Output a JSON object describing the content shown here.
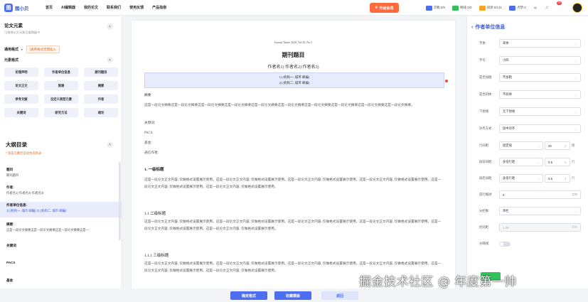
{
  "app": {
    "logo_char": "图",
    "logo_text": "图小贝"
  },
  "nav": [
    "首页",
    "AI编辑器",
    "我的论文",
    "联系我们",
    "使用反馈",
    "产品指南"
  ],
  "topbar": {
    "member_label": "升级会员",
    "quotas": [
      {
        "label": "次稿:0/5",
        "color": "#4e6ef2"
      },
      {
        "label": "畅排:0/0",
        "color": "#2fc25b"
      },
      {
        "label": "润译:0/131",
        "color": "#f5a623"
      },
      {
        "label": "点赞:0",
        "color": "#4e6ef2"
      }
    ],
    "notification_count": "99"
  },
  "left": {
    "section_title": "论文元素",
    "section_sub": "可拖拽论文元素至编辑器中",
    "format_label": "通用格式",
    "format_option": "(通用格式无需插入",
    "elements_label": "元素格式",
    "elements": [
      "论理声明",
      "作者单位信息",
      "期刊题目",
      "论文正文",
      "致谢",
      "摘要",
      "参考文献",
      "自定义类型元素",
      "作者",
      "关键词",
      "研究方法",
      "绪论"
    ],
    "outline_title": "大纲目录",
    "outline_tip": "* 双击元素后自动生成目录",
    "outline": [
      {
        "title": "题目",
        "value": "期刊题目"
      },
      {
        "title": "作者:",
        "value": "作者名1) 作者名2) 作者名3)"
      },
      {
        "title": "作者单位信息:",
        "value": "1) (机构一, 城市 邮编) 2) (机构二, 城市 邮编)"
      },
      {
        "title": "摘要:",
        "value": "这是一段论文摘要这是一段论文摘要这是一段论文摘要这是一"
      },
      {
        "title": "关键词",
        "value": ""
      },
      {
        "title": "PACS",
        "value": ""
      },
      {
        "title": "基金",
        "value": ""
      }
    ]
  },
  "doc": {
    "journal_info": "Journal Name 2020, Vol.45, No.5",
    "title": "期刊题目",
    "authors": "作者名1)  作者名2)  作者名3)",
    "affiliations": [
      "1) (机构一, 城市 邮编)",
      "2) (机构二, 城市 邮编)"
    ],
    "abstract_label": "摘要",
    "abstract_text": "这是一段论文摘要这是一段论文摘要这是一段论文摘要这是一段论文摘要这是一段论文摘要这是一段论文摘要这是一段论文摘要这是一段论文摘要这是一段论文摘要这是一段论文摘要。",
    "keywords_label": "关键词:",
    "pacs_label": "PACS:",
    "fund_label": "基金:",
    "correspond_label": "通信作者:",
    "h1": "1.   一级标题",
    "para": "这是一段论文正文内容, 仅做格式设置展示使用。这是一段论文正文内容, 仅做格式设置展示使用。这是一段论文正文内容, 仅做格式设置展示使用。这是一段论文正文内容, 仅做格式设置展示使用。这是一段论文正文内容, 仅做格式设置展示使用。这是一段论文正文内容, 仅做格式设置展示使用。",
    "h2": "1.1    二级标题",
    "h3": "1.1.1    三级标题"
  },
  "right": {
    "title": "作者单位信息",
    "rows": [
      {
        "label": "字体:",
        "value": "宋体"
      },
      {
        "label": "字号:",
        "value": "小四"
      },
      {
        "label": "是否加粗:",
        "value": "不加粗"
      },
      {
        "label": "是否斜体:",
        "value": "不斜体"
      },
      {
        "label": "下划线:",
        "value": "无下划线"
      },
      {
        "label": "对齐方式:",
        "value": "居中对齐"
      }
    ],
    "line_spacing": {
      "label": "行间距:",
      "mode": "固定值",
      "value": "20",
      "unit": "磅"
    },
    "space_before": {
      "label": "段前间距:",
      "mode": "多倍行距",
      "value": "0.5",
      "unit": "行"
    },
    "space_after": {
      "label": "段后间距:",
      "mode": "多倍行距",
      "value": "0.5",
      "unit": "行"
    },
    "indent": {
      "label": "首行缩进:",
      "value": "0",
      "unit": "字符"
    },
    "columns": {
      "label": "分栏数:",
      "value": "单栏"
    },
    "col_gap": {
      "label": "栏间距:",
      "value": "1.25",
      "unit": "字符"
    },
    "divider": {
      "label": "分隔线:"
    }
  },
  "bottom": {
    "confirm": "确定格式",
    "save": "收藏模板",
    "back": "返回"
  },
  "watermark": "掘金技术社区 @ 年度第一帅"
}
